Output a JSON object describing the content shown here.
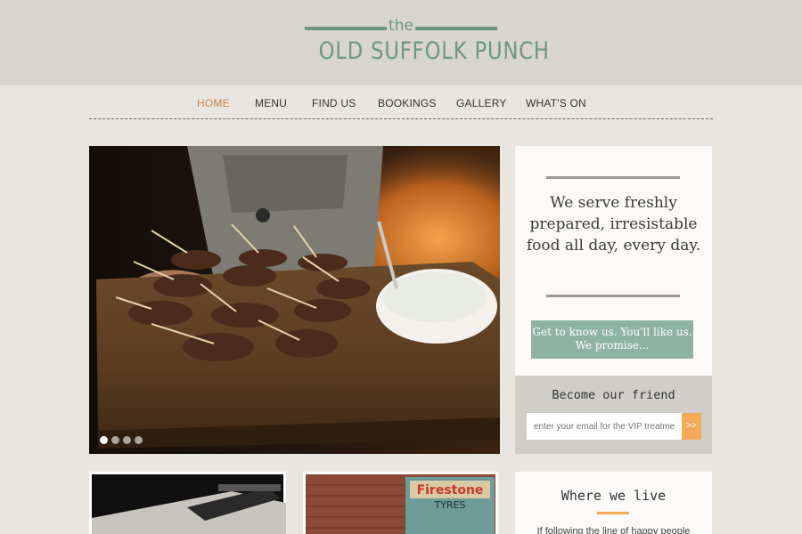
{
  "logo": {
    "the": "the",
    "name": "OLD SUFFOLK PUNCH"
  },
  "nav": {
    "items": [
      {
        "label": "HOME",
        "active": true
      },
      {
        "label": "MENU"
      },
      {
        "label": "FIND US"
      },
      {
        "label": "BOOKINGS"
      },
      {
        "label": "GALLERY"
      },
      {
        "label": "WHAT'S ON"
      }
    ]
  },
  "hero": {
    "image": "kebabs on a wooden board with a bowl of dip",
    "slides": 4,
    "active_slide": 1
  },
  "promo": {
    "tagline": "We serve freshly prepared, irresistable food all day, every day.",
    "cta": "Get to know us. You'll like us. We promise..."
  },
  "friend": {
    "title": "Become our friend",
    "email_placeholder": "enter your email for the VIP treatment",
    "submit": ">>"
  },
  "where": {
    "title": "Where we live",
    "snippet": "If following the line of happy people"
  },
  "thumbnails": [
    {
      "image": "dark menu board"
    },
    {
      "image": "brick wall with Firestone Tyres sign",
      "sign_text": "Firestone",
      "sign_sub": "TYRES"
    }
  ],
  "colors": {
    "accent_green": "#6e9583",
    "cta_green": "#8eb3a4",
    "active_nav": "#c2854e",
    "orange": "#f3a955"
  }
}
